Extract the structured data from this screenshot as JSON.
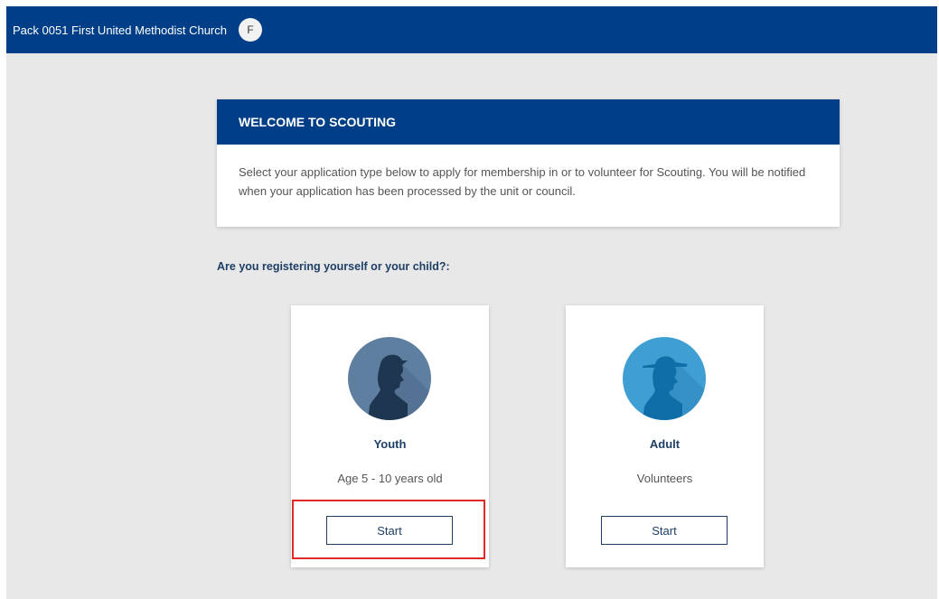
{
  "header": {
    "unit_name": "Pack 0051 First United Methodist Church",
    "avatar_initial": "F"
  },
  "welcome": {
    "title": "WELCOME TO SCOUTING",
    "body": "Select your application type below to apply for membership in or to volunteer for Scouting. You will be notified when your application has been processed by the unit or council."
  },
  "question": "Are you registering yourself or your child?:",
  "options": [
    {
      "title": "Youth",
      "subtitle": "Age 5 - 10 years old",
      "button_label": "Start",
      "icon": "youth-scout-icon",
      "icon_color": "#5f7fa0"
    },
    {
      "title": "Adult",
      "subtitle": "Volunteers",
      "button_label": "Start",
      "icon": "adult-scout-icon",
      "icon_color": "#3f9fd2"
    }
  ],
  "colors": {
    "brand": "#003f87",
    "highlight": "#e02a2a",
    "background": "#e8e8e8"
  }
}
